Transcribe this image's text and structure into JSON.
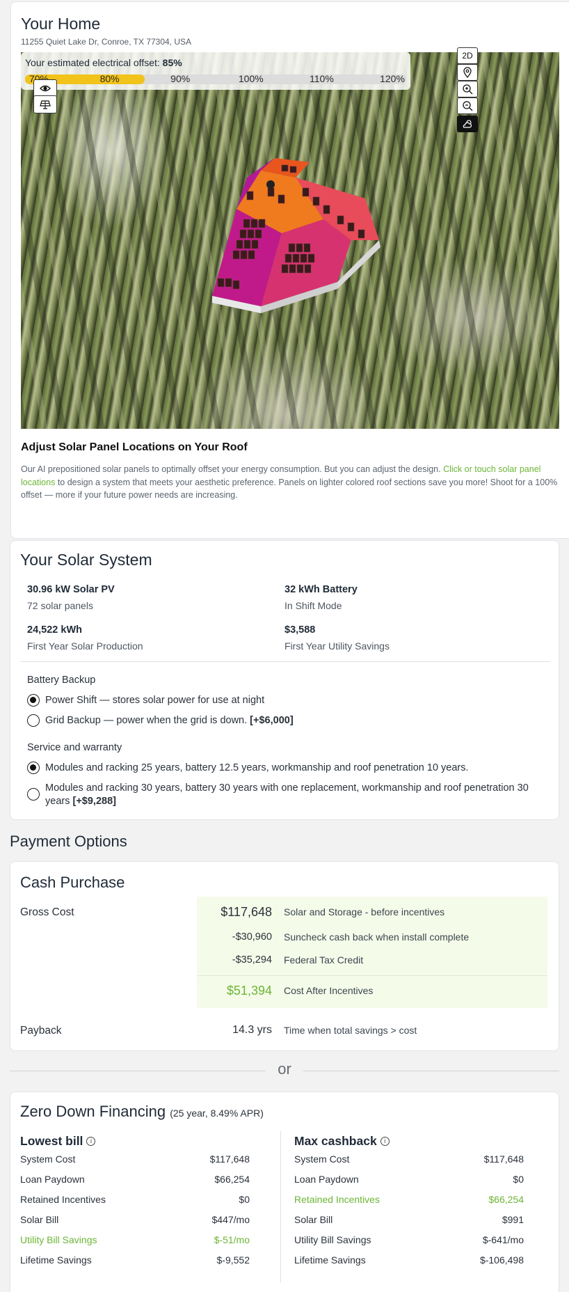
{
  "home": {
    "title": "Your Home",
    "address": "11255 Quiet Lake Dr, Conroe, TX 77304, USA"
  },
  "offset": {
    "label": "Your estimated electrical offset: ",
    "value": "85%",
    "fill_percent": 85,
    "ticks": [
      "70%",
      "80%",
      "90%",
      "100%",
      "110%",
      "120%"
    ]
  },
  "map_controls": {
    "view_2d": "2D",
    "icons": [
      "eye-icon",
      "solar-panel-icon",
      "location-pin-icon",
      "zoom-in-icon",
      "zoom-out-icon",
      "weather-icon"
    ]
  },
  "adjust": {
    "title": "Adjust Solar Panel Locations on Your Roof",
    "text_before": "Our AI prepositioned solar panels to optimally offset your energy consumption. But you can adjust the design. ",
    "link": "Click or touch solar panel locations",
    "text_after": " to design a system that meets your aesthetic preference. Panels on lighter colored roof sections save you more! Shoot for a 100% offset — more if your future power needs are increasing."
  },
  "solar_system": {
    "title": "Your Solar System",
    "stats": [
      {
        "value": "30.96 kW Solar PV",
        "label": "72 solar panels"
      },
      {
        "value": "32 kWh Battery",
        "label": "In Shift Mode"
      },
      {
        "value": "24,522 kWh",
        "label": "First Year Solar Production"
      },
      {
        "value": "$3,588",
        "label": "First Year Utility Savings"
      }
    ],
    "battery_backup": {
      "label": "Battery Backup",
      "options": [
        {
          "text": "Power Shift — stores solar power for use at night",
          "extra": "",
          "checked": true
        },
        {
          "text": "Grid Backup — power when the grid is down. ",
          "extra": "[+$6,000]",
          "checked": false
        }
      ]
    },
    "warranty": {
      "label": "Service and warranty",
      "options": [
        {
          "text": "Modules and racking 25 years, battery 12.5 years, workmanship and roof penetration 10 years.",
          "extra": "",
          "checked": true
        },
        {
          "text": "Modules and racking 30 years, battery 30 years with one replacement, workmanship and roof penetration 30 years ",
          "extra": "[+$9,288]",
          "checked": false
        }
      ]
    }
  },
  "payment": {
    "title": "Payment Options",
    "cash": {
      "title": "Cash Purchase",
      "gross_label": "Gross Cost",
      "rows": [
        {
          "amount": "$117,648",
          "desc": "Solar and Storage - before incentives"
        },
        {
          "amount": "-$30,960",
          "desc": "Suncheck cash back when install complete"
        },
        {
          "amount": "-$35,294",
          "desc": "Federal Tax Credit"
        },
        {
          "amount": "$51,394",
          "desc": "Cost After Incentives"
        }
      ],
      "payback_label": "Payback",
      "payback_value": "14.3 yrs",
      "payback_desc": "Time when total savings > cost"
    },
    "or": "or",
    "financing": {
      "title": "Zero Down Financing",
      "subtitle": "(25 year, 8.49% APR)",
      "lowest": {
        "title": "Lowest bill",
        "rows": [
          {
            "label": "System Cost",
            "value": "$117,648"
          },
          {
            "label": "Loan Paydown",
            "value": "$66,254"
          },
          {
            "label": "Retained Incentives",
            "value": "$0"
          },
          {
            "label": "Solar Bill",
            "value": "$447/mo"
          },
          {
            "label": "Utility Bill Savings",
            "value": "$-51/mo"
          },
          {
            "label": "Lifetime Savings",
            "value": "$-9,552"
          }
        ]
      },
      "max": {
        "title": "Max cashback",
        "rows": [
          {
            "label": "System Cost",
            "value": "$117,648"
          },
          {
            "label": "Loan Paydown",
            "value": "$0"
          },
          {
            "label": "Retained Incentives",
            "value": "$66,254"
          },
          {
            "label": "Solar Bill",
            "value": "$991"
          },
          {
            "label": "Utility Bill Savings",
            "value": "$-641/mo"
          },
          {
            "label": "Lifetime Savings",
            "value": "$-106,498"
          }
        ]
      }
    }
  },
  "colors": {
    "accent_green": "#6bb535",
    "offset_yellow": "#f2c31a",
    "highlight_bg": "#f5fbe9"
  }
}
